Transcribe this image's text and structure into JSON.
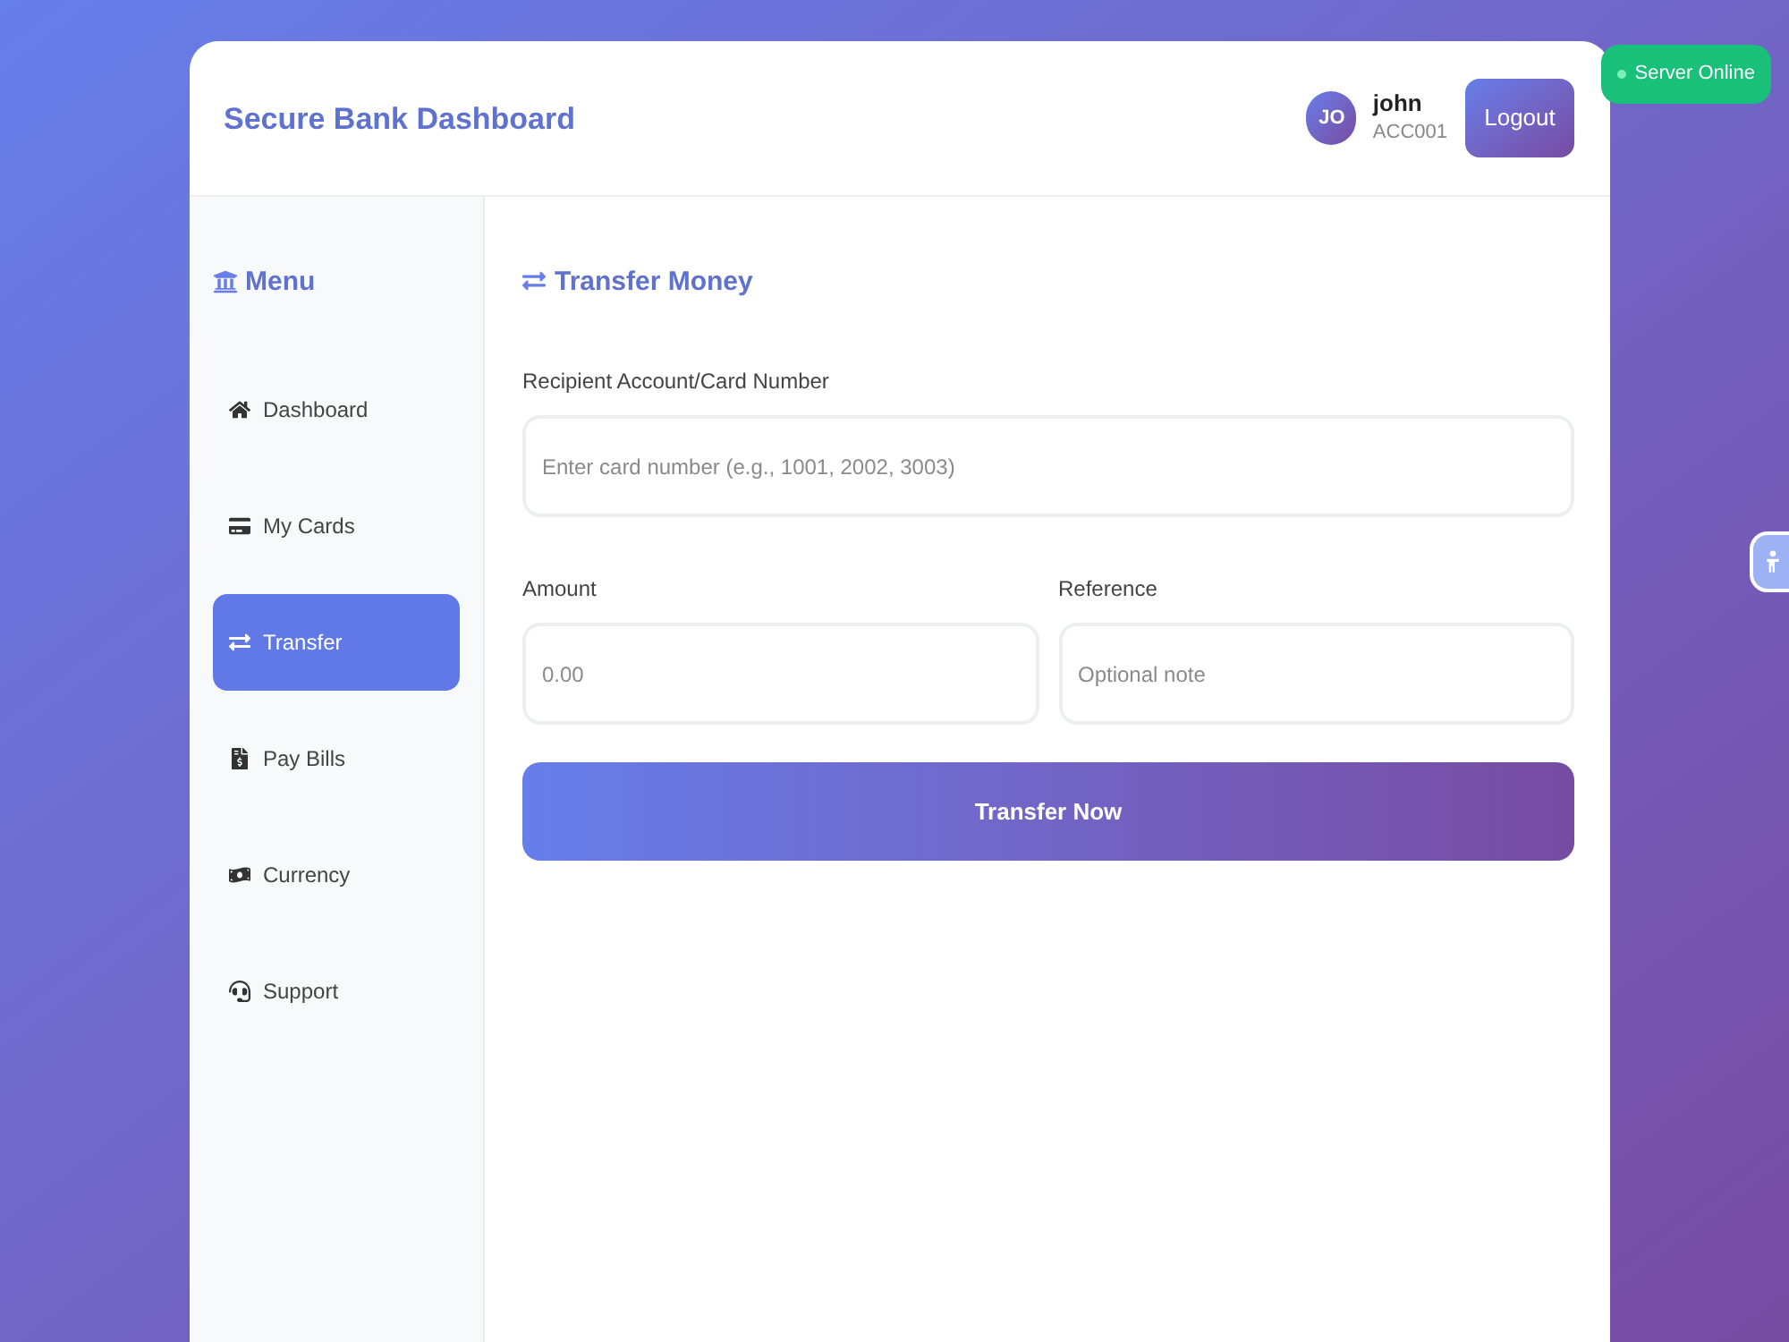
{
  "header": {
    "title": "Secure Bank Dashboard",
    "user": {
      "initials": "JO",
      "name": "john",
      "account": "ACC001"
    },
    "logout_button": "Logout"
  },
  "server_status": {
    "label": "Server Online",
    "online": true
  },
  "sidebar": {
    "title": "Menu",
    "items": [
      {
        "label": "Dashboard",
        "selected": false
      },
      {
        "label": "My Cards",
        "selected": false
      },
      {
        "label": "Transfer",
        "selected": true
      },
      {
        "label": "Pay Bills",
        "selected": false
      },
      {
        "label": "Currency",
        "selected": false
      },
      {
        "label": "Support",
        "selected": false
      }
    ]
  },
  "transfer_form": {
    "title": "Transfer Money",
    "recipient": {
      "label": "Recipient Account/Card Number",
      "placeholder": "Enter card number (e.g., 1001, 2002, 3003)"
    },
    "amount": {
      "label": "Amount",
      "placeholder": "0.00"
    },
    "reference": {
      "label": "Reference",
      "placeholder": "Optional note"
    },
    "submit_button": "Transfer Now"
  }
}
